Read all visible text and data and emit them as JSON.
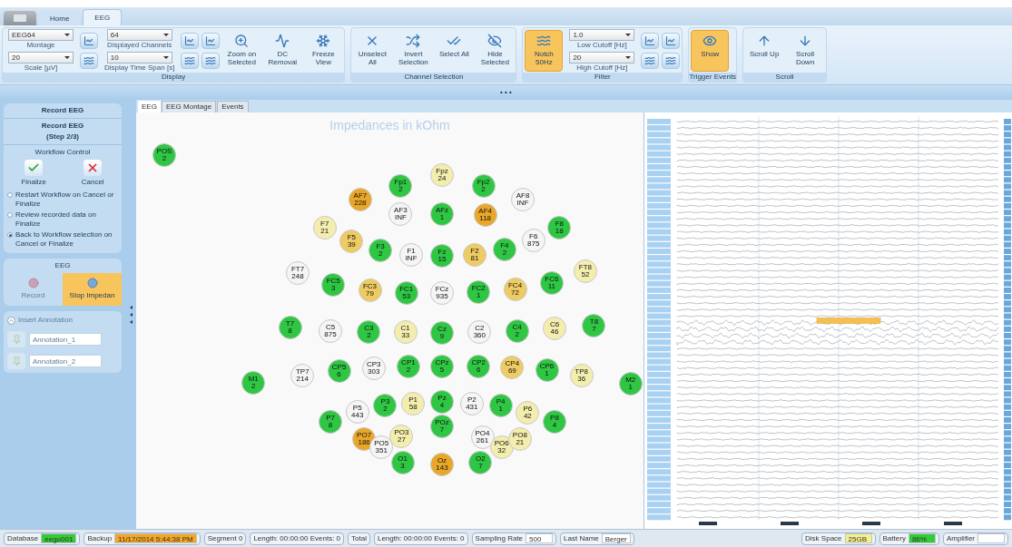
{
  "app_tabs": [
    {
      "label": "Home",
      "selected": false
    },
    {
      "label": "EEG",
      "selected": true
    }
  ],
  "ribbon": {
    "groups": [
      {
        "title": "Display",
        "items": [
          {
            "kind": "dropdowns",
            "fields": [
              {
                "value": "EEG64",
                "label": "Montage"
              },
              {
                "value": "20",
                "label": "Scale [µV]"
              }
            ]
          },
          {
            "kind": "icon_pair"
          },
          {
            "kind": "dropdowns",
            "fields": [
              {
                "value": "64",
                "label": "Displayed Channels"
              },
              {
                "value": "10",
                "label": "Display Time Span [s]"
              }
            ]
          },
          {
            "kind": "icon_pair"
          },
          {
            "kind": "icon_pair"
          },
          {
            "kind": "button",
            "label": "Zoom on Selected",
            "active": false
          },
          {
            "kind": "button",
            "label": "DC Removal",
            "active": false
          },
          {
            "kind": "button",
            "label": "Freeze View",
            "active": false
          }
        ]
      },
      {
        "title": "Channel Selection",
        "items": [
          {
            "kind": "button",
            "label": "Unselect All",
            "active": false
          },
          {
            "kind": "button",
            "label": "Invert Selection",
            "active": false
          },
          {
            "kind": "button",
            "label": "Select All",
            "active": false
          },
          {
            "kind": "button",
            "label": "Hide Selected",
            "active": false
          }
        ]
      },
      {
        "title": "Filter",
        "items": [
          {
            "kind": "button",
            "label": "Notch 50Hz",
            "active": true
          },
          {
            "kind": "dropdowns",
            "fields": [
              {
                "value": "1.0",
                "label": "Low Cutoff [Hz]"
              },
              {
                "value": "20",
                "label": "High Cutoff [Hz]"
              }
            ]
          },
          {
            "kind": "icon_pair"
          },
          {
            "kind": "icon_pair"
          }
        ]
      },
      {
        "title": "Trigger Events",
        "items": [
          {
            "kind": "button",
            "label": "Show",
            "active": true
          }
        ]
      },
      {
        "title": "Scroll",
        "items": [
          {
            "kind": "button",
            "label": "Scroll Up",
            "active": false
          },
          {
            "kind": "button",
            "label": "Scroll Down",
            "active": false
          }
        ]
      }
    ]
  },
  "collapse_bar": {
    "label": "• • •"
  },
  "workflow": {
    "header": "Record EEG",
    "step_title": "Record EEG",
    "step": "(Step 2/3)",
    "control_title": "Workflow Control",
    "actions": [
      {
        "label": "Finalize"
      },
      {
        "label": "Cancel"
      }
    ],
    "options": [
      {
        "label": "Restart Workflow on Cancel or Finalize",
        "selected": false
      },
      {
        "label": "Review recorded data on Finalize",
        "selected": false
      },
      {
        "label": "Back to Workflow selection on Cancel or Finalize",
        "selected": true
      }
    ]
  },
  "eeg_panel": {
    "title": "EEG",
    "buttons": [
      {
        "label": "Record",
        "active": false,
        "disabled": true
      },
      {
        "label": "Stop Impedan",
        "active": true,
        "disabled": false
      }
    ]
  },
  "annotations": {
    "title": "Insert Annotation",
    "disabled": true,
    "fields": [
      {
        "value": "Annotation_1"
      },
      {
        "value": "Annotation_2"
      }
    ]
  },
  "doc_tabs": [
    {
      "label": "EEG",
      "selected": true
    },
    {
      "label": "EEG Montage",
      "selected": false
    },
    {
      "label": "Events",
      "selected": false
    }
  ],
  "impedance_map": {
    "title": "Impedances in kOhm",
    "electrodes": [
      {
        "name": "POS",
        "value": "2",
        "color": "#2fc644"
      },
      {
        "name": "Fpz",
        "value": "24",
        "color": "#f4eeae"
      },
      {
        "name": "Fp1",
        "value": "2",
        "color": "#2fc644"
      },
      {
        "name": "Fp2",
        "value": "2",
        "color": "#2fc644"
      },
      {
        "name": "AF7",
        "value": "228",
        "color": "#e9a72a"
      },
      {
        "name": "AF3",
        "value": "INF",
        "color": "#f5f5f5"
      },
      {
        "name": "AFz",
        "value": "1",
        "color": "#2fc644"
      },
      {
        "name": "AF4",
        "value": "118",
        "color": "#e9a72a"
      },
      {
        "name": "AF8",
        "value": "INF",
        "color": "#f5f5f5"
      },
      {
        "name": "F7",
        "value": "21",
        "color": "#f4eeae"
      },
      {
        "name": "F5",
        "value": "39",
        "color": "#eecb63"
      },
      {
        "name": "F3",
        "value": "2",
        "color": "#2fc644"
      },
      {
        "name": "F1",
        "value": "INF",
        "color": "#f5f5f5"
      },
      {
        "name": "Fz",
        "value": "15",
        "color": "#2fc644"
      },
      {
        "name": "F2",
        "value": "81",
        "color": "#eecb63"
      },
      {
        "name": "F4",
        "value": "2",
        "color": "#2fc644"
      },
      {
        "name": "F6",
        "value": "875",
        "color": "#f5f5f5"
      },
      {
        "name": "F8",
        "value": "18",
        "color": "#2fc644"
      },
      {
        "name": "FT7",
        "value": "248",
        "color": "#f5f5f5"
      },
      {
        "name": "FC5",
        "value": "3",
        "color": "#2fc644"
      },
      {
        "name": "FC3",
        "value": "79",
        "color": "#eecb63"
      },
      {
        "name": "FC1",
        "value": "53",
        "color": "#2fc644"
      },
      {
        "name": "FCz",
        "value": "935",
        "color": "#f5f5f5"
      },
      {
        "name": "FC2",
        "value": "1",
        "color": "#2fc644"
      },
      {
        "name": "FC4",
        "value": "72",
        "color": "#eecb63"
      },
      {
        "name": "FC6",
        "value": "11",
        "color": "#2fc644"
      },
      {
        "name": "FT8",
        "value": "52",
        "color": "#f4eeae"
      },
      {
        "name": "T7",
        "value": "8",
        "color": "#2fc644"
      },
      {
        "name": "C5",
        "value": "875",
        "color": "#f5f5f5"
      },
      {
        "name": "C3",
        "value": "2",
        "color": "#2fc644"
      },
      {
        "name": "C1",
        "value": "33",
        "color": "#f4eeae"
      },
      {
        "name": "Cz",
        "value": "9",
        "color": "#2fc644"
      },
      {
        "name": "C2",
        "value": "360",
        "color": "#f5f5f5"
      },
      {
        "name": "C4",
        "value": "2",
        "color": "#2fc644"
      },
      {
        "name": "C6",
        "value": "46",
        "color": "#f4eeae"
      },
      {
        "name": "T8",
        "value": "7",
        "color": "#2fc644"
      },
      {
        "name": "M1",
        "value": "2",
        "color": "#2fc644"
      },
      {
        "name": "TP7",
        "value": "214",
        "color": "#f5f5f5"
      },
      {
        "name": "CP5",
        "value": "6",
        "color": "#2fc644"
      },
      {
        "name": "CP3",
        "value": "303",
        "color": "#f5f5f5"
      },
      {
        "name": "CP1",
        "value": "2",
        "color": "#2fc644"
      },
      {
        "name": "CPz",
        "value": "5",
        "color": "#2fc644"
      },
      {
        "name": "CP2",
        "value": "6",
        "color": "#2fc644"
      },
      {
        "name": "CP4",
        "value": "69",
        "color": "#eecb63"
      },
      {
        "name": "CP6",
        "value": "1",
        "color": "#2fc644"
      },
      {
        "name": "TP8",
        "value": "36",
        "color": "#f4eeae"
      },
      {
        "name": "M2",
        "value": "1",
        "color": "#2fc644"
      },
      {
        "name": "P7",
        "value": "8",
        "color": "#2fc644"
      },
      {
        "name": "P5",
        "value": "443",
        "color": "#f5f5f5"
      },
      {
        "name": "P3",
        "value": "2",
        "color": "#2fc644"
      },
      {
        "name": "P1",
        "value": "58",
        "color": "#f4eeae"
      },
      {
        "name": "Pz",
        "value": "4",
        "color": "#2fc644"
      },
      {
        "name": "P2",
        "value": "431",
        "color": "#f5f5f5"
      },
      {
        "name": "P4",
        "value": "1",
        "color": "#2fc644"
      },
      {
        "name": "P6",
        "value": "42",
        "color": "#f4eeae"
      },
      {
        "name": "P8",
        "value": "4",
        "color": "#2fc644"
      },
      {
        "name": "PO7",
        "value": "186",
        "color": "#e9a72a"
      },
      {
        "name": "PO5",
        "value": "351",
        "color": "#f5f5f5"
      },
      {
        "name": "PO3",
        "value": "27",
        "color": "#f4eeae"
      },
      {
        "name": "POz",
        "value": "7",
        "color": "#2fc644"
      },
      {
        "name": "PO4",
        "value": "261",
        "color": "#f5f5f5"
      },
      {
        "name": "PO6",
        "value": "32",
        "color": "#f4eeae"
      },
      {
        "name": "PO8",
        "value": "21",
        "color": "#f4eeae"
      },
      {
        "name": "O1",
        "value": "3",
        "color": "#2fc644"
      },
      {
        "name": "Oz",
        "value": "143",
        "color": "#e9a72a"
      },
      {
        "name": "O2",
        "value": "7",
        "color": "#2fc644"
      }
    ]
  },
  "status_bar": {
    "left": [
      {
        "label": "Database",
        "value": "eego001",
        "color": "#33cc33"
      },
      {
        "label": "Backup",
        "value": "11/17/2014 5:44:38 PM",
        "color": "#f5a623"
      },
      {
        "label": "Segment 0"
      },
      {
        "label": "Length: 00:00:00 Events: 0"
      },
      {
        "label": "Total"
      },
      {
        "label": "Length: 00:00:00 Events: 0"
      },
      {
        "label": "Sampling Rate",
        "value": "500",
        "color": "#ffffff"
      },
      {
        "label": "Last Name",
        "value": "Berger",
        "color": "#ffffff"
      }
    ],
    "right": [
      {
        "label": "Disk Space",
        "value": "25GB",
        "color": "#f7f08a"
      },
      {
        "label": "Battery",
        "value": "86%",
        "color": "#33cc33"
      },
      {
        "label": "Amplifier",
        "color": "#ffffff"
      }
    ]
  }
}
